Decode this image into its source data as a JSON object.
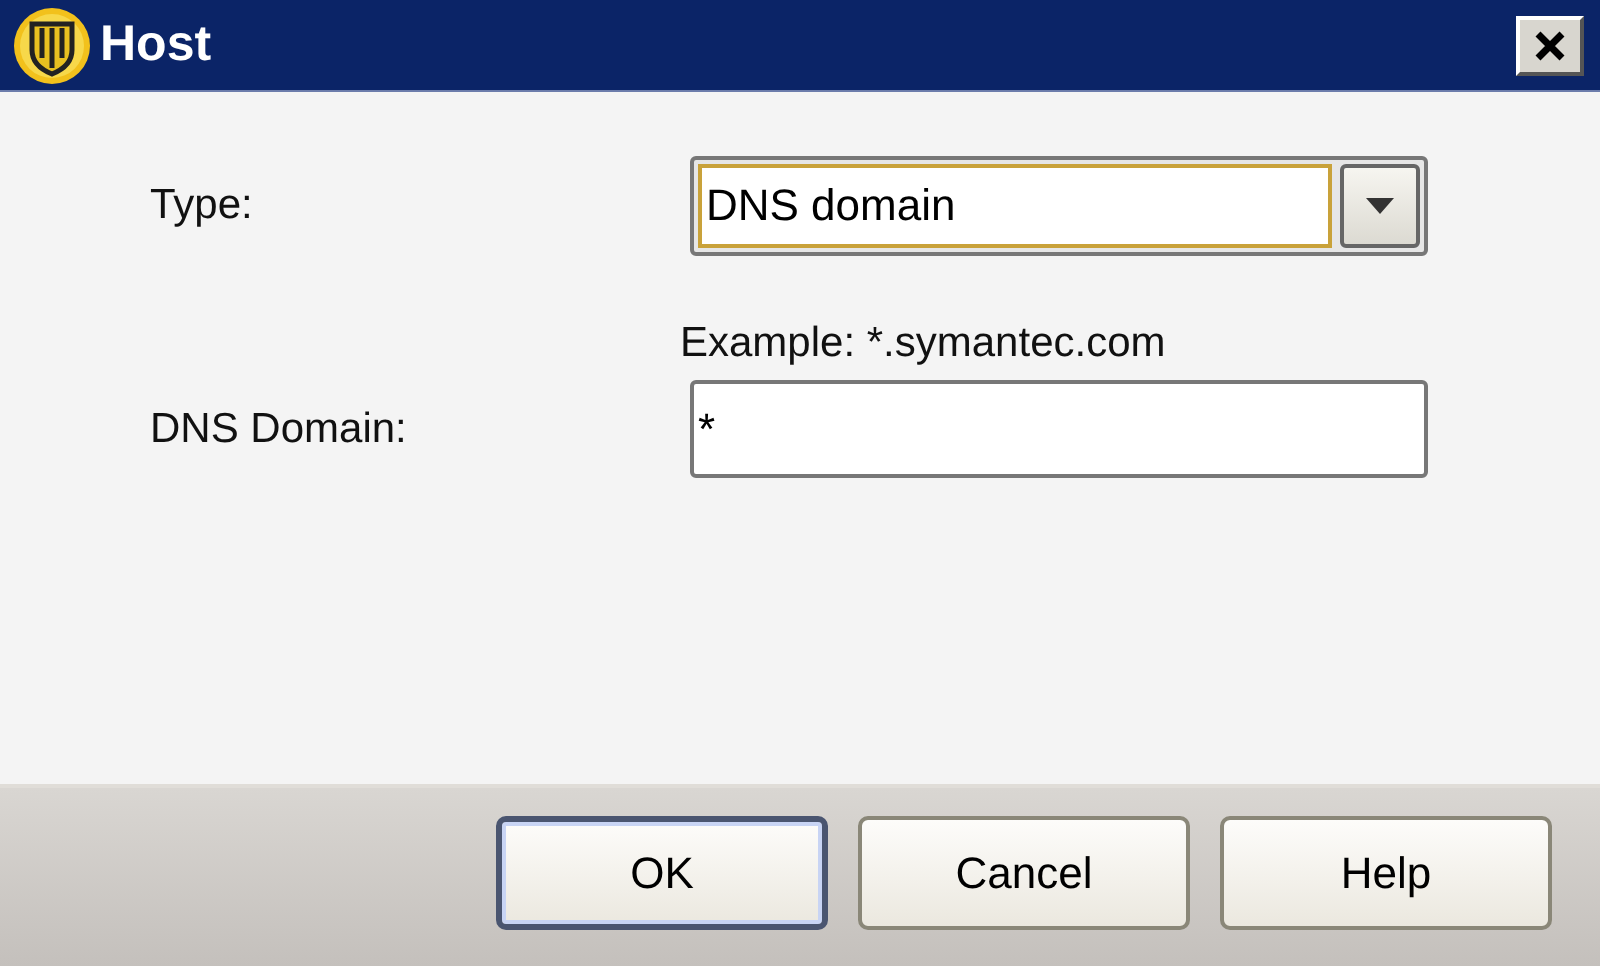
{
  "window": {
    "title": "Host"
  },
  "fields": [
    {
      "kind": "dropdown",
      "label": "Type:",
      "value": "DNS domain",
      "focused": true
    },
    {
      "kind": "text",
      "label": "DNS Domain:",
      "hint": "Example: *.symantec.com",
      "value": "*",
      "focused": false
    }
  ],
  "buttons": [
    {
      "label": "OK",
      "default": true
    },
    {
      "label": "Cancel",
      "default": false
    },
    {
      "label": "Help",
      "default": false
    }
  ]
}
